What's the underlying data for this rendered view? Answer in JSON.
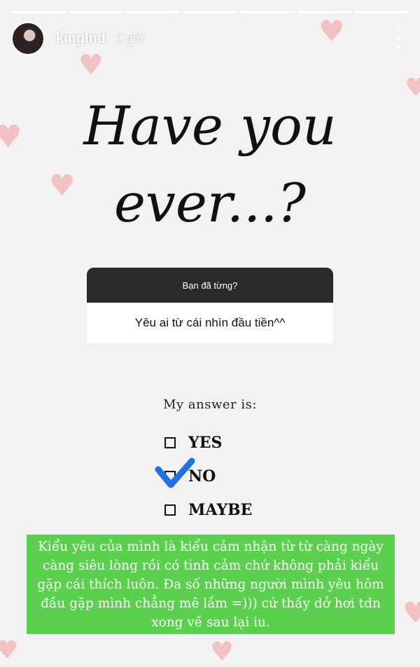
{
  "story": {
    "username": "kinglnd",
    "time": "2 giờ",
    "progress_segments": 7
  },
  "card": {
    "title_line1": "Have you",
    "title_line2": "ever...?"
  },
  "question": {
    "header": "Bạn đã từng?",
    "answer": "Yêu ai từ cái nhìn đầu tiền^^"
  },
  "answer_section": {
    "label": "My answer is:",
    "options": [
      "YES",
      "NO",
      "MAYBE"
    ],
    "selected": "NO"
  },
  "caption": {
    "text": "Kiểu yêu của mình là kiểu cảm nhận từ từ càng ngày càng siêu lòng rồi có tình cảm chứ không phải kiểu gặp cái thích luôn. Đa số những người mình yêu hôm đầu gặp mình chẳng mê lắm =))) cứ thấy dở hơi tdn xong về sau lại iu."
  },
  "colors": {
    "caption_bg": "#5bd04f",
    "question_header_bg": "#2a2a2a",
    "check_color": "#1e73e0"
  }
}
